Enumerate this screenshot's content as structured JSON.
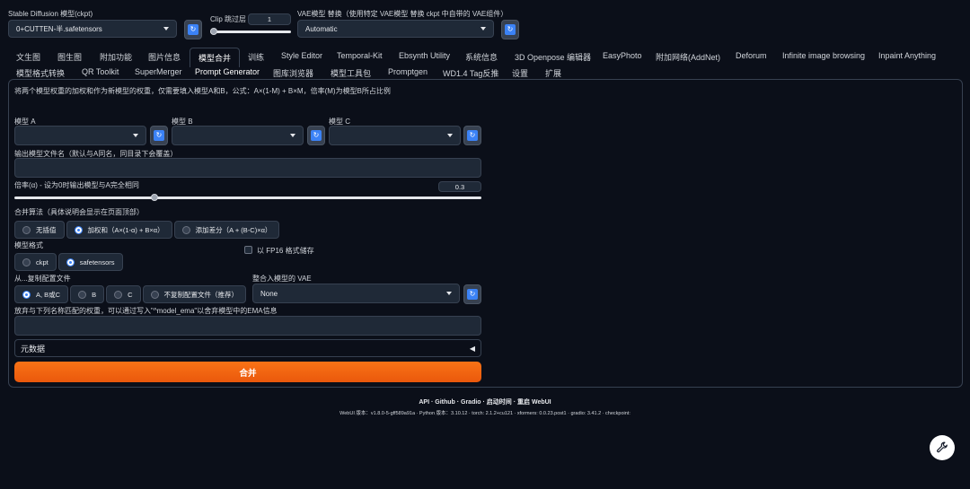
{
  "top": {
    "sd_model_label": "Stable Diffusion 模型(ckpt)",
    "sd_model_value": "0+CUTTEN-半.safetensors",
    "clip_label": "Clip 跳过层",
    "clip_value": "1",
    "vae_label": "VAE模型 替换（使用特定 VAE模型 替换 ckpt 中自带的 VAE组件）",
    "vae_value": "Automatic"
  },
  "tabs_row1": [
    "文生图",
    "图生图",
    "附加功能",
    "图片信息",
    "模型合并",
    "训练",
    "Style Editor",
    "Temporal-Kit",
    "Ebsynth Utility",
    "系统信息",
    "3D Openpose 编辑器",
    "EasyPhoto",
    "附加网络(AddNet)",
    "Deforum",
    "Infinite image browsing",
    "Inpaint Anything"
  ],
  "tabs_row2": [
    "模型格式转换",
    "QR Toolkit",
    "SuperMerger",
    "Prompt Generator",
    "图库浏览器",
    "模型工具包",
    "Promptgen",
    "WD1.4 Tag反推",
    "设置",
    "扩展"
  ],
  "active_tab": "模型合并",
  "merge": {
    "description": "将两个模型权重的加权和作为新模型的权重，仅需要填入模型A和B，公式：A×(1-M) + B×M，倍率(M)为模型B所占比例",
    "model_a_label": "模型 A",
    "model_b_label": "模型 B",
    "model_c_label": "模型 C",
    "output_name_label": "输出模型文件名（默认与A同名，同目录下会覆盖）",
    "multiplier_label": "倍率(α) - 设为0时输出模型与A完全相同",
    "multiplier_value": "0.3",
    "multiplier": 0.3,
    "method_label": "合并算法（具体说明会显示在页面顶部）",
    "methods": [
      "无插值",
      "加权和（A×(1-α) + B×α）",
      "添加差分（A + (B-C)×α）"
    ],
    "method_selected": 1,
    "format_label": "模型格式",
    "formats": [
      "ckpt",
      "safetensors"
    ],
    "format_selected": 1,
    "fp16_label": "以 FP16 格式储存",
    "copy_config_label": "从...复制配置文件",
    "copy_options": [
      "A, B或C",
      "B",
      "C",
      "不复制配置文件（推荐）"
    ],
    "copy_selected": 0,
    "bake_vae_label": "整合入模型的 VAE",
    "bake_vae_value": "None",
    "discard_label": "放弃与下列名称匹配的权重，可以通过写入\"^model_ema\"以舍弃模型中的EMA信息",
    "metadata_label": "元数据",
    "merge_button": "合并"
  },
  "footer": {
    "links": "API · Github · Gradio · 启动时间 · 重启 WebUI",
    "version": "WebUI 版本：v1.8.0-5-gff589a91a  ·  Python 版本：3.10.12  ·  torch: 2.1.2+cu121  ·  xformers: 0.0.23.post1  ·  gradio: 3.41.2  ·  checkpoint:"
  },
  "colors": {
    "accent": "#3b82f6",
    "merge_button": "#f97316",
    "background": "#0b0f19"
  },
  "icons": {
    "refresh": "refresh-icon",
    "settings": "wrench-icon"
  }
}
